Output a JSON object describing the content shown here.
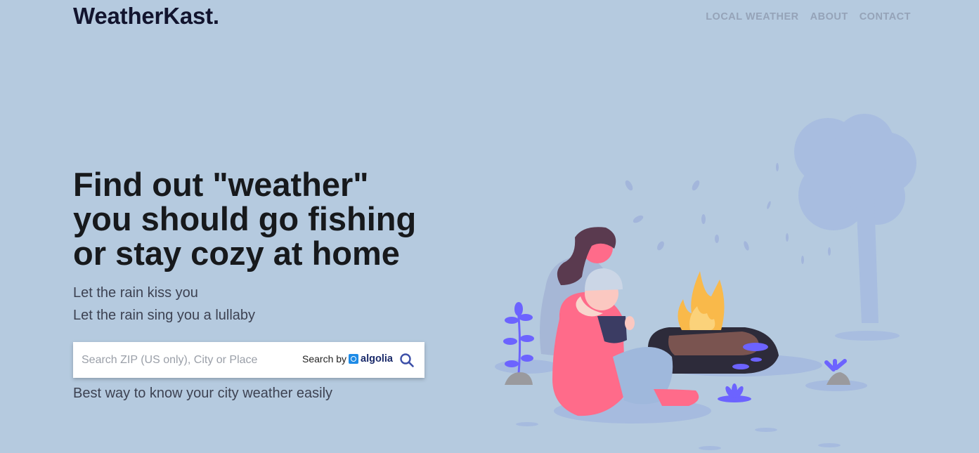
{
  "header": {
    "logo": "WeatherKast.",
    "nav": [
      "LOCAL WEATHER",
      "ABOUT",
      "CONTACT"
    ]
  },
  "hero": {
    "headline_lines": [
      "Find out \"weather\"",
      "you should go fishing",
      "or stay cozy at home"
    ],
    "tagline_1": "Let the rain kiss you",
    "tagline_2": "Let the rain sing you a lullaby",
    "bottom_line": "Best way to know your city weather easily"
  },
  "search": {
    "placeholder": "Search ZIP (US only), City or Place",
    "value": "",
    "powered_by": "Search by",
    "provider": "algolia",
    "button_icon": "search-icon"
  },
  "illustration": {
    "description_icon": "campfire-couple-icon"
  },
  "colors": {
    "background": "#b5cadf",
    "accent": "#6c63ff",
    "sweater": "#ff6b8a",
    "flame": "#f9b94a"
  }
}
